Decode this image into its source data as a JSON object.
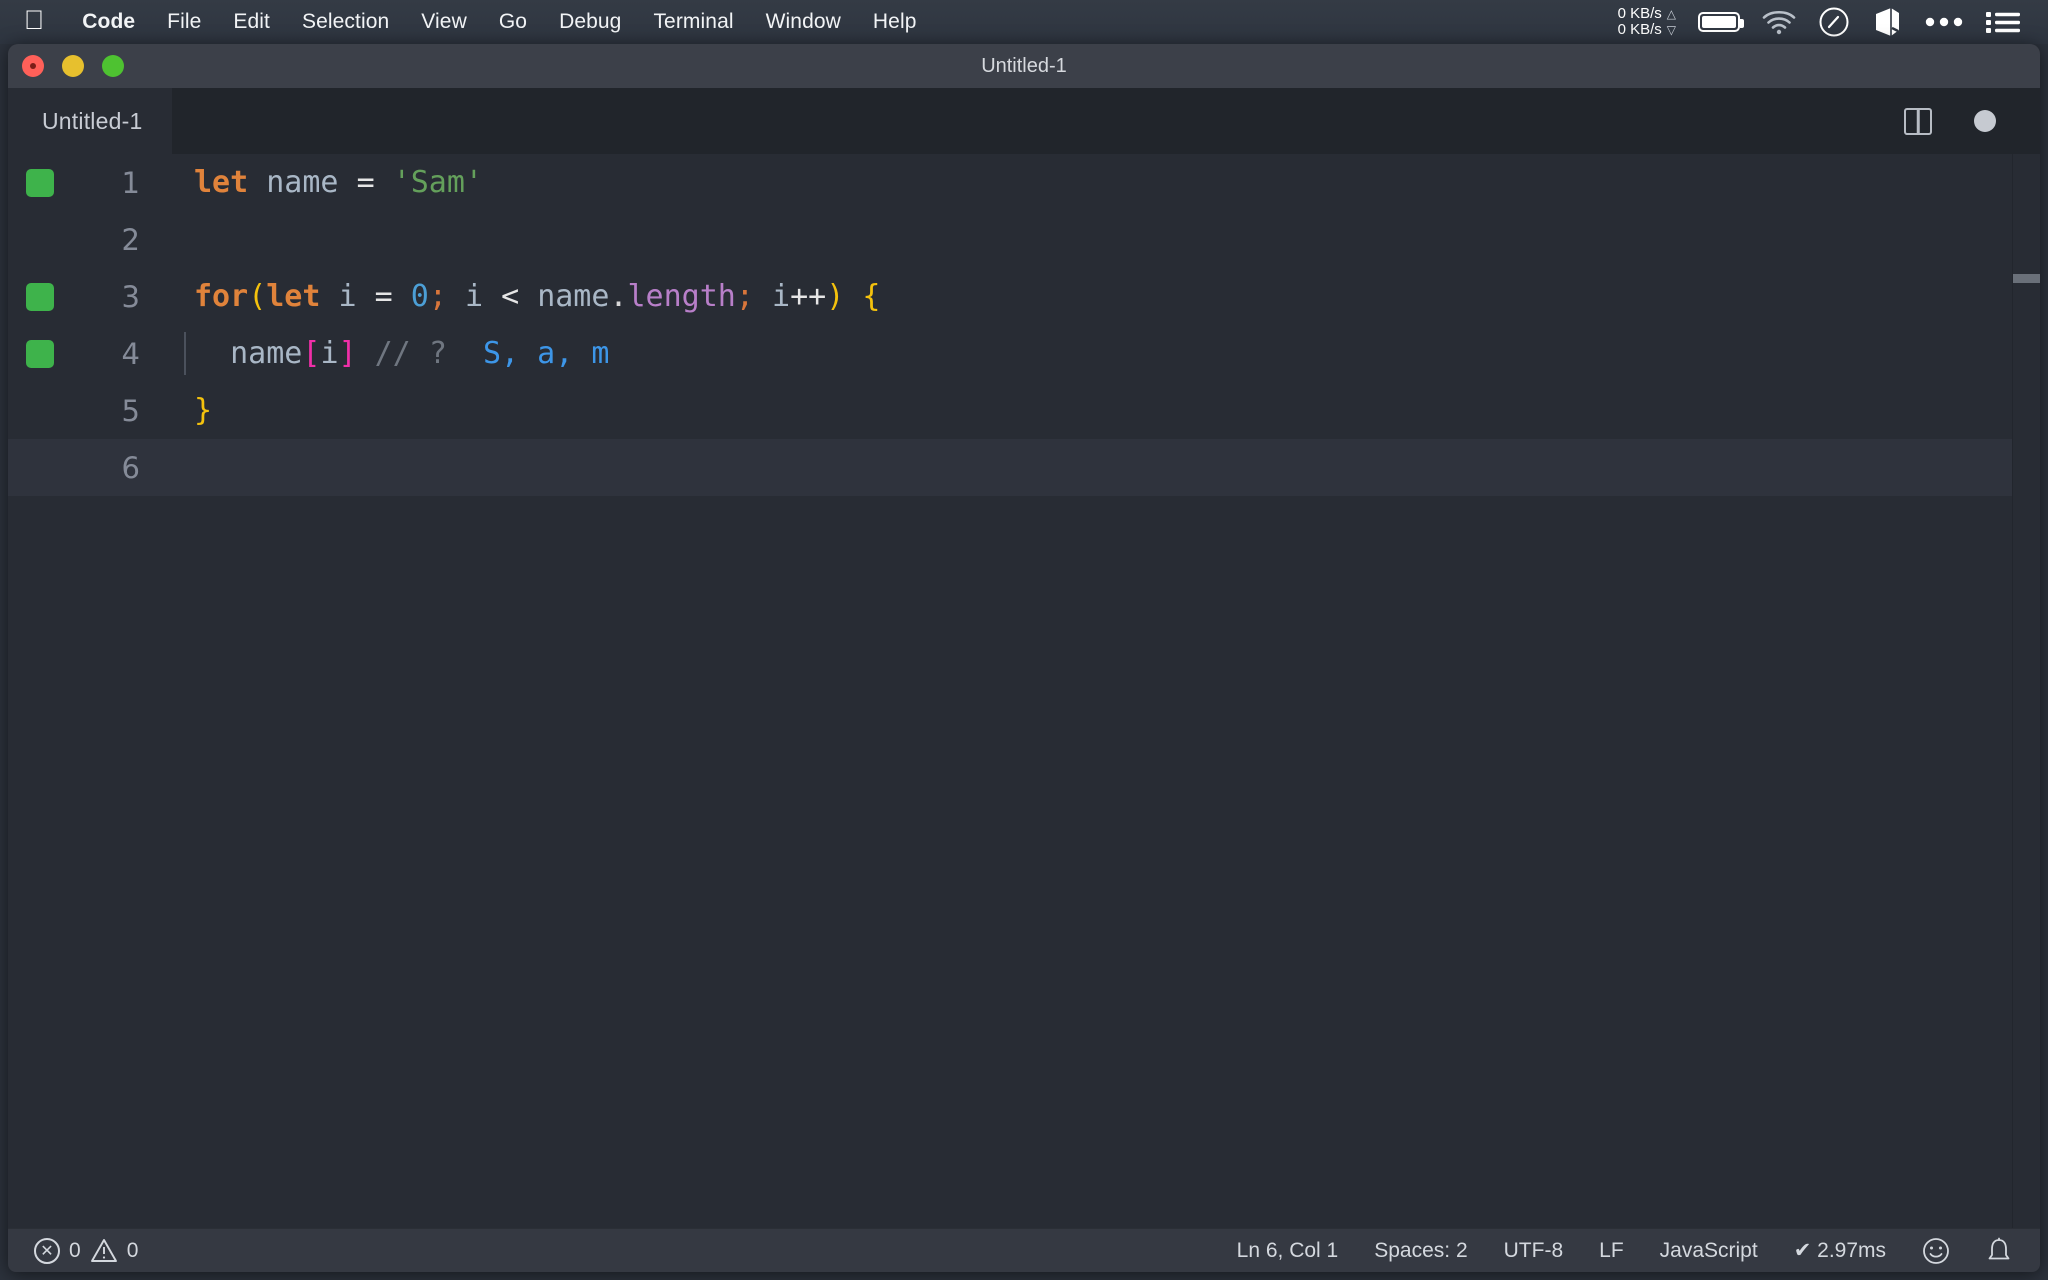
{
  "menubar": {
    "apple_icon": "apple-logo-icon",
    "items": [
      {
        "label": "Code",
        "bold": true
      },
      {
        "label": "File",
        "bold": false
      },
      {
        "label": "Edit",
        "bold": false
      },
      {
        "label": "Selection",
        "bold": false
      },
      {
        "label": "View",
        "bold": false
      },
      {
        "label": "Go",
        "bold": false
      },
      {
        "label": "Debug",
        "bold": false
      },
      {
        "label": "Terminal",
        "bold": false
      },
      {
        "label": "Window",
        "bold": false
      },
      {
        "label": "Help",
        "bold": false
      }
    ],
    "network": {
      "upload": "0 KB/s",
      "download": "0 KB/s",
      "up_arrow": "△",
      "down_arrow": "▽"
    },
    "status_icons": [
      "battery-icon",
      "wifi-icon",
      "speedometer-icon",
      "cube-icon",
      "ellipsis-icon",
      "list-icon"
    ]
  },
  "window": {
    "title": "Untitled-1",
    "traffic_lights": [
      "close-button",
      "minimize-button",
      "zoom-button"
    ]
  },
  "tabbar": {
    "tab_label": "Untitled-1",
    "split_editor_label": "split-editor-icon",
    "dirty_indicator_label": "unsaved-changes-dot"
  },
  "editor": {
    "lines": [
      {
        "number": "1",
        "marker": true,
        "indent_guide": false,
        "current": false,
        "tokens": [
          {
            "text": "let",
            "cls": "t-kw"
          },
          {
            "text": " ",
            "cls": "t-op"
          },
          {
            "text": "name",
            "cls": "t-var"
          },
          {
            "text": " ",
            "cls": "t-op"
          },
          {
            "text": "=",
            "cls": "t-op"
          },
          {
            "text": " ",
            "cls": "t-op"
          },
          {
            "text": "'Sam'",
            "cls": "t-str"
          }
        ]
      },
      {
        "number": "2",
        "marker": false,
        "indent_guide": false,
        "current": false,
        "tokens": []
      },
      {
        "number": "3",
        "marker": true,
        "indent_guide": false,
        "current": false,
        "tokens": [
          {
            "text": "for",
            "cls": "t-kw"
          },
          {
            "text": "(",
            "cls": "t-brkt-y"
          },
          {
            "text": "let",
            "cls": "t-kw"
          },
          {
            "text": " ",
            "cls": "t-op"
          },
          {
            "text": "i",
            "cls": "t-var"
          },
          {
            "text": " ",
            "cls": "t-op"
          },
          {
            "text": "=",
            "cls": "t-op"
          },
          {
            "text": " ",
            "cls": "t-op"
          },
          {
            "text": "0",
            "cls": "t-num"
          },
          {
            "text": ";",
            "cls": "t-semi"
          },
          {
            "text": " ",
            "cls": "t-op"
          },
          {
            "text": "i",
            "cls": "t-var"
          },
          {
            "text": " ",
            "cls": "t-op"
          },
          {
            "text": "<",
            "cls": "t-op"
          },
          {
            "text": " ",
            "cls": "t-op"
          },
          {
            "text": "name",
            "cls": "t-var"
          },
          {
            "text": ".",
            "cls": "t-punct"
          },
          {
            "text": "length",
            "cls": "t-prop"
          },
          {
            "text": ";",
            "cls": "t-semi"
          },
          {
            "text": " ",
            "cls": "t-op"
          },
          {
            "text": "i",
            "cls": "t-var"
          },
          {
            "text": "++",
            "cls": "t-op"
          },
          {
            "text": ")",
            "cls": "t-brkt-y"
          },
          {
            "text": " ",
            "cls": "t-op"
          },
          {
            "text": "{",
            "cls": "t-brkt-y"
          }
        ]
      },
      {
        "number": "4",
        "marker": true,
        "indent_guide": true,
        "current": false,
        "tokens": [
          {
            "text": "  ",
            "cls": "t-op"
          },
          {
            "text": "name",
            "cls": "t-var"
          },
          {
            "text": "[",
            "cls": "t-brkt-p"
          },
          {
            "text": "i",
            "cls": "t-var"
          },
          {
            "text": "]",
            "cls": "t-brkt-p"
          },
          {
            "text": " ",
            "cls": "t-op"
          },
          {
            "text": "//",
            "cls": "t-comment"
          },
          {
            "text": " ",
            "cls": "t-op"
          },
          {
            "text": "?",
            "cls": "t-comment"
          },
          {
            "text": "  ",
            "cls": "t-op"
          },
          {
            "text": "S, a, m",
            "cls": "t-live"
          }
        ]
      },
      {
        "number": "5",
        "marker": false,
        "indent_guide": false,
        "current": false,
        "tokens": [
          {
            "text": "}",
            "cls": "t-brkt-y"
          }
        ]
      },
      {
        "number": "6",
        "marker": false,
        "indent_guide": false,
        "current": true,
        "tokens": []
      }
    ]
  },
  "statusbar": {
    "errors": "0",
    "warnings": "0",
    "error_icon": "error-circle-icon",
    "warning_icon": "warning-triangle-icon",
    "cursor_position": "Ln 6, Col 1",
    "indentation": "Spaces: 2",
    "encoding": "UTF-8",
    "eol": "LF",
    "language": "JavaScript",
    "runtime": "✔ 2.97ms",
    "feedback_icon": "smiley-icon",
    "notifications_icon": "bell-icon"
  },
  "colors": {
    "editor_background": "#282c34",
    "tabbar_background": "#21252b",
    "statusbar_background": "#353942",
    "marker_green": "#3eb34b",
    "keyword_orange": "#e0833b",
    "string_green": "#64a05b",
    "number_blue": "#4c9fd6",
    "property_purple": "#b87fc9",
    "bracket_yellow": "#f4c20d",
    "bracket_pink": "#f02fa8",
    "comment_gray": "#6f7680",
    "live_value_blue": "#3d96e8"
  }
}
